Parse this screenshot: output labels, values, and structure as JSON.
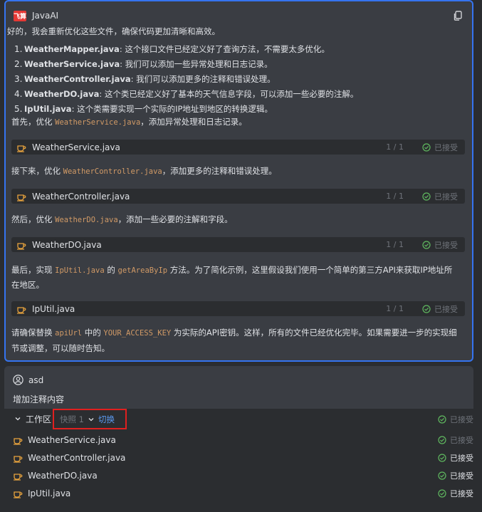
{
  "ai": {
    "name": "JavaAI",
    "logo_text": "飞算",
    "intro": "好的，我会重新优化这些文件，确保代码更加清晰和高效。",
    "items": [
      {
        "num": "1.",
        "file": "WeatherMapper.java",
        "desc": ": 这个接口文件已经定义好了查询方法，不需要太多优化。"
      },
      {
        "num": "2.",
        "file": "WeatherService.java",
        "desc": ": 我们可以添加一些异常处理和日志记录。"
      },
      {
        "num": "3.",
        "file": "WeatherController.java",
        "desc": ": 我们可以添加更多的注释和错误处理。"
      },
      {
        "num": "4.",
        "file": "WeatherDO.java",
        "desc": ": 这个类已经定义好了基本的天气信息字段，可以添加一些必要的注解。"
      },
      {
        "num": "5.",
        "file": "IpUtil.java",
        "desc": ": 这个类需要实现一个实际的IP地址到地区的转换逻辑。"
      }
    ],
    "p1": {
      "pre": "首先，优化 ",
      "code": "WeatherService.java",
      "post": "，添加异常处理和日志记录。"
    },
    "p2": {
      "pre": "接下来，优化 ",
      "code": "WeatherController.java",
      "post": "，添加更多的注释和错误处理。"
    },
    "p3": {
      "pre": "然后，优化 ",
      "code": "WeatherDO.java",
      "post": "，添加一些必要的注解和字段。"
    },
    "p4": {
      "pre": "最后，实现 ",
      "code1": "IpUtil.java",
      "mid": " 的 ",
      "code2": "getAreaByIp",
      "post": " 方法。为了简化示例，这里假设我们使用一个简单的第三方API来获取IP地址所",
      "line2": "在地区。"
    },
    "p5": {
      "pre": "请确保替换 ",
      "code1": "apiUrl",
      "mid": " 中的 ",
      "code2": "YOUR_ACCESS_KEY",
      "post": " 为实际的API密钥。这样，所有的文件已经优化完毕。如果需要进一步的实现细",
      "line2": "节或调整，可以随时告知。"
    },
    "file_bars": [
      {
        "name": "WeatherService.java",
        "counter": "1 / 1",
        "status": "已接受"
      },
      {
        "name": "WeatherController.java",
        "counter": "1 / 1",
        "status": "已接受"
      },
      {
        "name": "WeatherDO.java",
        "counter": "1 / 1",
        "status": "已接受"
      },
      {
        "name": "IpUtil.java",
        "counter": "1 / 1",
        "status": "已接受"
      }
    ]
  },
  "user": {
    "name": "asd",
    "message": "增加注释内容"
  },
  "workspace": {
    "title": "工作区",
    "snapshot_label": "快照 1",
    "switch_label": "切换",
    "status": "已接受",
    "files": [
      {
        "name": "WeatherService.java",
        "status": "已接受"
      },
      {
        "name": "WeatherController.java",
        "status": "已接受"
      },
      {
        "name": "WeatherDO.java",
        "status": "已接受"
      },
      {
        "name": "IpUtil.java",
        "status": "已接受"
      }
    ]
  },
  "colors": {
    "accent": "#3574f0",
    "code": "#d19a66",
    "link": "#5c9cf5",
    "accepted_dim": "#6f737a",
    "accepted_bright": "#dfe1e5",
    "check_green": "#5fb85f",
    "highlight": "#e0201f"
  }
}
